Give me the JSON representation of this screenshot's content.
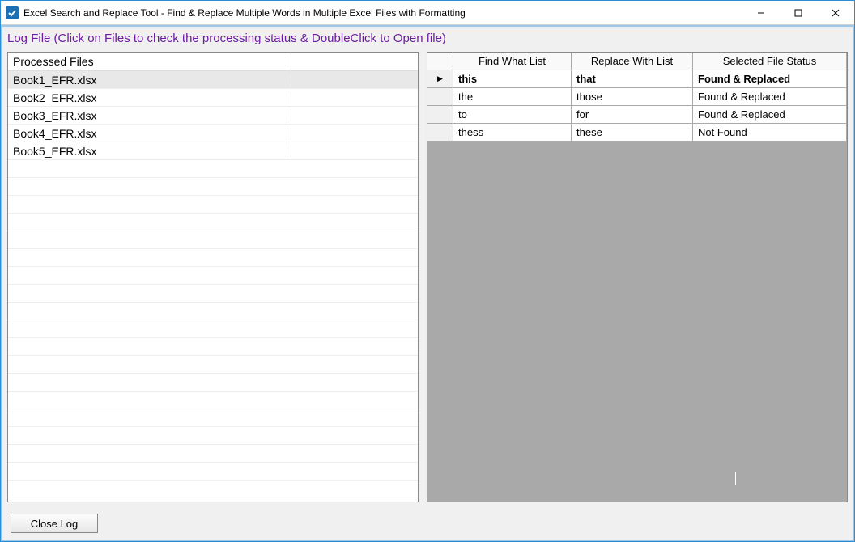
{
  "window": {
    "title": "Excel Search and Replace Tool - Find & Replace Multiple Words in Multiple Excel Files with Formatting"
  },
  "header_message": "Log File (Click on Files to check the processing status & DoubleClick to Open file)",
  "left_panel": {
    "header1": "Processed Files",
    "header2": "",
    "rows": [
      {
        "name": "Book1_EFR.xlsx",
        "selected": true
      },
      {
        "name": "Book2_EFR.xlsx",
        "selected": false
      },
      {
        "name": "Book3_EFR.xlsx",
        "selected": false
      },
      {
        "name": "Book4_EFR.xlsx",
        "selected": false
      },
      {
        "name": "Book5_EFR.xlsx",
        "selected": false
      }
    ],
    "blank_rows": 19
  },
  "right_panel": {
    "col1": "Find What List",
    "col2": "Replace With List",
    "col3": "Selected File Status",
    "rows": [
      {
        "find": "this",
        "replace": "that",
        "status": "Found & Replaced",
        "selected": true
      },
      {
        "find": "the",
        "replace": "those",
        "status": "Found & Replaced",
        "selected": false
      },
      {
        "find": "to",
        "replace": "for",
        "status": "Found & Replaced",
        "selected": false
      },
      {
        "find": "thess",
        "replace": "these",
        "status": "Not Found",
        "selected": false
      }
    ]
  },
  "buttons": {
    "close_log": "Close Log"
  }
}
